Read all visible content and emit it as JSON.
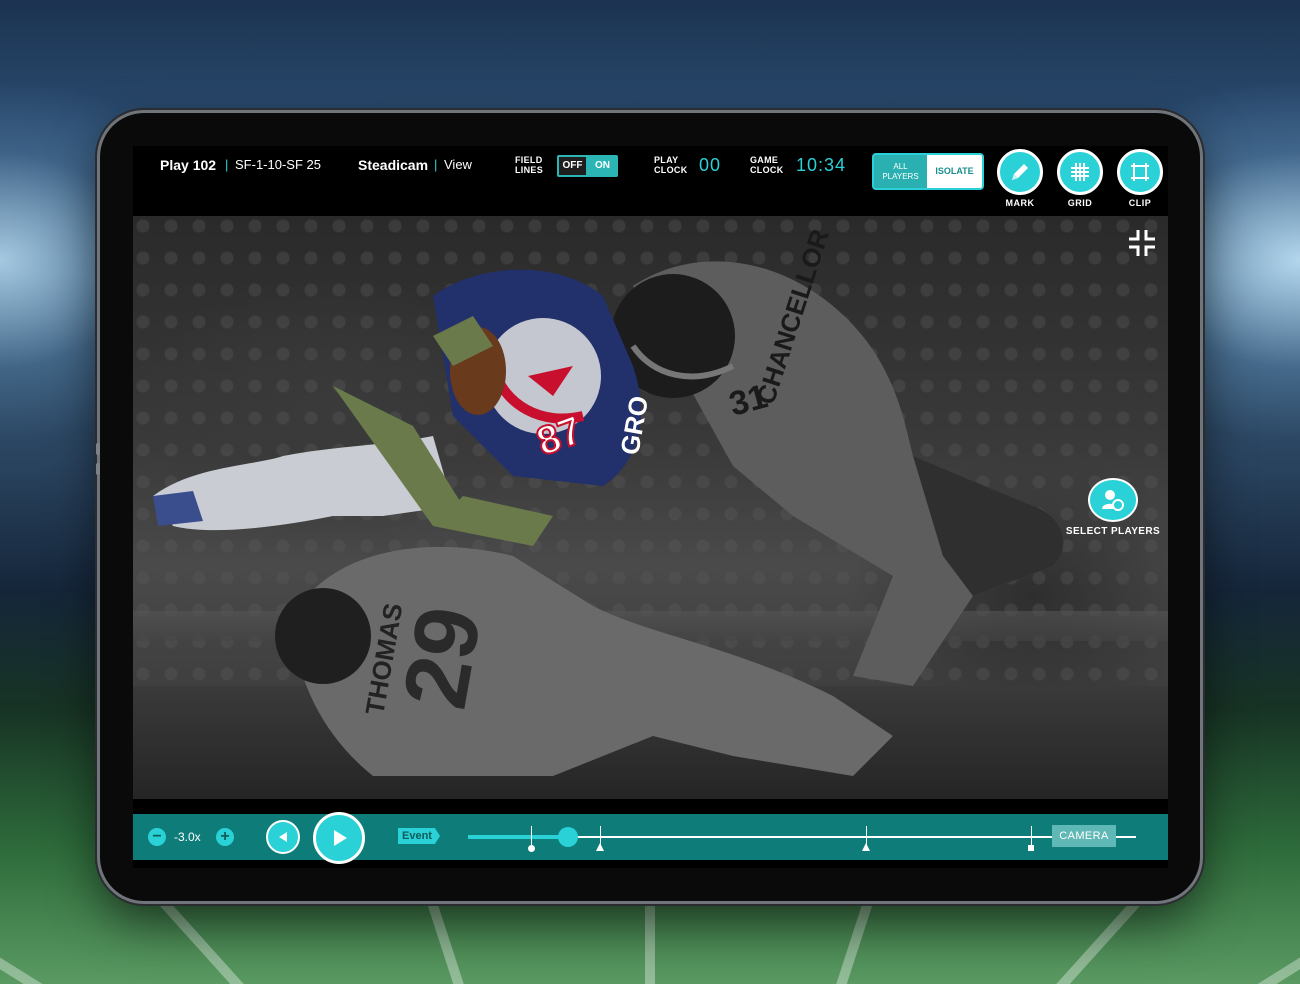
{
  "header": {
    "play_label": "Play 102",
    "down_distance": "SF-1-10-SF 25",
    "camera_name": "Steadicam",
    "camera_view": "View",
    "field_lines_label_1": "FIELD",
    "field_lines_label_2": "LINES",
    "field_lines_off": "OFF",
    "field_lines_on": "ON",
    "play_clock_label_1": "PLAY",
    "play_clock_label_2": "CLOCK",
    "play_clock_value": "00",
    "game_clock_label_1": "GAME",
    "game_clock_label_2": "CLOCK",
    "game_clock_value": "10:34",
    "view_mode_all_1": "ALL",
    "view_mode_all_2": "PLAYERS",
    "view_mode_isolate": "ISOLATE",
    "tools": [
      {
        "label": "MARK",
        "icon": "pencil-icon"
      },
      {
        "label": "GRID",
        "icon": "grid-icon"
      },
      {
        "label": "CLIP",
        "icon": "crop-icon"
      }
    ]
  },
  "video": {
    "select_players_label": "SELECT PLAYERS",
    "jerseys": [
      "87",
      "31",
      "29"
    ],
    "nameplates": [
      "CHANCELLOR",
      "THOMAS",
      "GRO"
    ]
  },
  "timeline": {
    "minus": "−",
    "plus": "+",
    "speed": "-3.0x",
    "event_label": "Event",
    "camera_label": "CAMERA"
  },
  "colors": {
    "accent": "#2ad1d6",
    "timeline_bg": "#0e7d7a",
    "camera_btn": "#5fb8b5"
  }
}
